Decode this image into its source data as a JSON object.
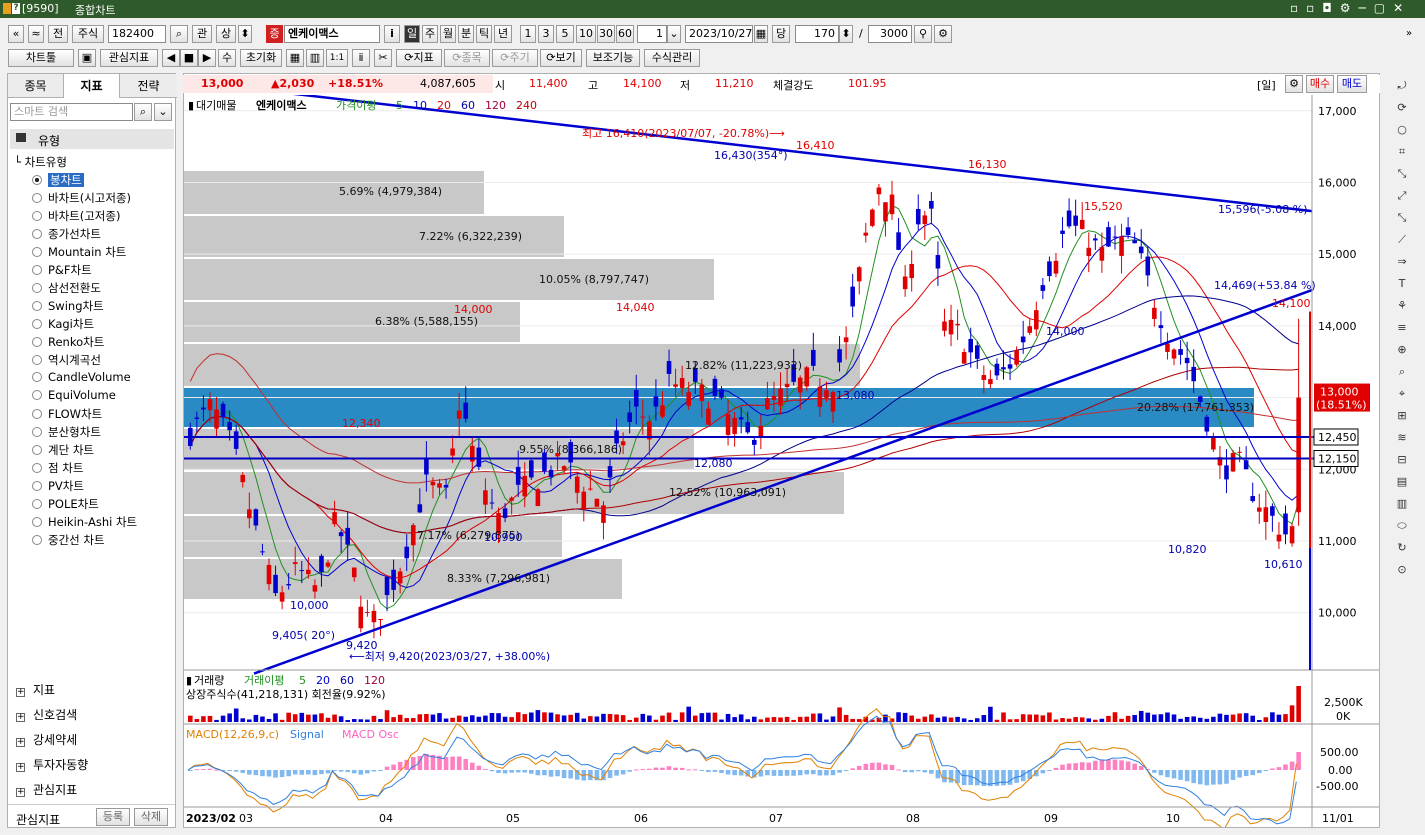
{
  "window": {
    "code": "[9590]",
    "title": "종합차트"
  },
  "toolbar1": {
    "nav_prev": "«",
    "nav_up": "≈",
    "jeon": "전",
    "market": "주식",
    "code": "182400",
    "search_icon": "⌕",
    "gwan": "관",
    "sang": "상",
    "spinner": "⬍",
    "badge": "증",
    "stock_name": "엔케이맥스",
    "info": "i",
    "periods": [
      "일",
      "주",
      "월",
      "분",
      "틱",
      "년"
    ],
    "nums": [
      "1",
      "3",
      "5",
      "10",
      "30",
      "60"
    ],
    "count_one": "1",
    "date": "2023/10/27",
    "dang": "당",
    "amount": "170",
    "slash": "/",
    "total": "3000"
  },
  "toolbar2": {
    "chart_tool": "차트툴",
    "save": "💾",
    "fav_indicator": "관심지표",
    "nav": [
      "◀",
      "■",
      "▶"
    ],
    "su": "수",
    "reset": "초기화",
    "grid": [
      "▦",
      "▥",
      "1:1",
      "ⅱ"
    ],
    "indicator": "⟳지표",
    "stock": "⟳종목",
    "cycle": "⟳주기",
    "view": "⟳보기",
    "aux": "보조기능",
    "formula": "수식관리"
  },
  "sidebar": {
    "tabs": [
      "종목",
      "지표",
      "전략"
    ],
    "search_placeholder": "스마트 검색",
    "type_header": "유형",
    "chart_type_header": "차트유형",
    "chart_types": [
      "봉차트",
      "바차트(시고저종)",
      "바차트(고저종)",
      "종가선차트",
      "Mountain 차트",
      "P&F차트",
      "삼선전환도",
      "Swing차트",
      "Kagi차트",
      "Renko차트",
      "역시계곡선",
      "CandleVolume",
      "EquiVolume",
      "FLOW차트",
      "분산형차트",
      "계단 차트",
      "점 차트",
      "PV차트",
      "POLE차트",
      "Heikin-Ashi 차트",
      "중간선 차트"
    ],
    "sections": [
      "지표",
      "신호검색",
      "강세약세",
      "투자자동향",
      "관심지표"
    ],
    "bottom": {
      "label": "관심지표",
      "add": "등록",
      "del": "삭제"
    }
  },
  "infobar": {
    "price": "13,000",
    "change": "▲2,030",
    "pct": "+18.51%",
    "volume": "4,087,605",
    "open_l": "시",
    "open": "11,400",
    "high_l": "고",
    "high": "14,100",
    "low_l": "저",
    "low": "11,210",
    "strength_l": "체결강도",
    "strength": "101.95",
    "period": "[일]",
    "buy": "매수",
    "sell": "매도"
  },
  "chart": {
    "legend": {
      "mark": "▮",
      "title": "대기매물",
      "name": "엔케이맥스",
      "ma_label": "가격이평",
      "mas": [
        "5",
        "10",
        "20",
        "60",
        "120",
        "240"
      ]
    },
    "ylabels": [
      "17,000",
      "16,000",
      "15,000",
      "14,000",
      "13,000",
      "12,000",
      "11,000",
      "10,000"
    ],
    "xlabels": [
      "2023/02",
      "03",
      "04",
      "05",
      "06",
      "07",
      "08",
      "09",
      "10",
      "11/01"
    ],
    "price_tag": "13,000",
    "price_tag_pct": "(18.51%)",
    "hline1": "12,450",
    "hline2": "12,150",
    "volume_profile": [
      "5.69% (4,979,384)",
      "7.22% (6,322,239)",
      "10.05% (8,797,747)",
      "6.38% (5,588,155)",
      "12.82% (11,223,932)",
      "20.28% (17,761,353)",
      "9.55% (8,366,186)",
      "12.52% (10,963,091)",
      "7.17% (6,279,875)",
      "8.33% (7,296,981)"
    ],
    "annotations": {
      "top_high": "최고 16,410(2023/07/07, -20.78%)⟶",
      "low_note": "⟵최저 9,420(2023/03/27, +38.00%)",
      "upper_line": "16,430(354°)",
      "upper_line_end": "15,596(-5.08 %)",
      "lower_line_start": "9,405( 20°)",
      "lower_line_end": "14,469(+53.84 %)"
    },
    "price_labels_red": [
      "16,410",
      "16,130",
      "15,520",
      "14,000",
      "14,040",
      "12,340",
      "14,100"
    ],
    "price_labels_blue": [
      "13,080",
      "12,080",
      "14,000",
      "10,000",
      "9,420",
      "10,820",
      "10,610",
      "10,990"
    ],
    "volume": {
      "title": "거래량",
      "ma_label": "거래이평",
      "mas": [
        "5",
        "20",
        "60",
        "120"
      ],
      "shares": "상장주식수(41,218,131) 회전율(9.92%)",
      "ylabels": [
        "2,500K",
        "0K"
      ]
    },
    "macd": {
      "title": "MACD(12,26,9,c)",
      "signal": "Signal",
      "osc": "MACD Osc",
      "ylabels": [
        "500.00",
        "0.00",
        "-500.00"
      ]
    }
  },
  "colors": {
    "red": "#e00000",
    "blue": "#0000d0",
    "title_green": "#2f5a2b",
    "band": "#2a8ac4"
  }
}
